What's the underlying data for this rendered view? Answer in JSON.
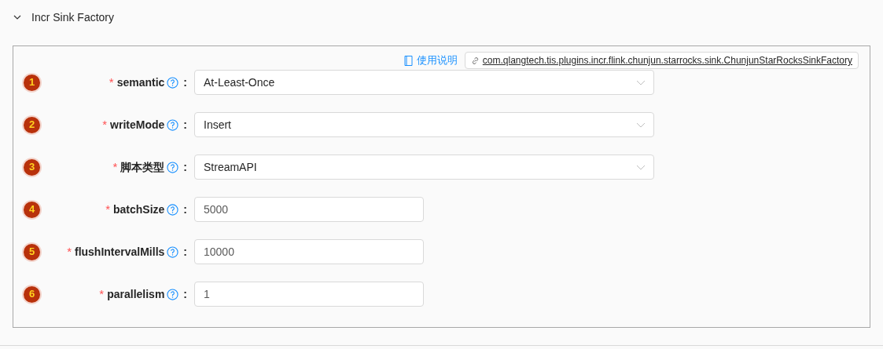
{
  "section": {
    "title": "Incr Sink Factory",
    "expanded": true
  },
  "doc_link": "使用说明",
  "plugin_link": "com.qlangtech.tis.plugins.incr.flink.chunjun.starrocks.sink.ChunjunStarRocksSinkFactory",
  "fields": [
    {
      "badge": "1",
      "label": "semantic",
      "required": true,
      "kind": "select",
      "value": "At-Least-Once"
    },
    {
      "badge": "2",
      "label": "writeMode",
      "required": true,
      "kind": "select",
      "value": "Insert"
    },
    {
      "badge": "3",
      "label": "脚本类型",
      "required": true,
      "kind": "select",
      "value": "StreamAPI"
    },
    {
      "badge": "4",
      "label": "batchSize",
      "required": true,
      "kind": "input",
      "value": "5000"
    },
    {
      "badge": "5",
      "label": "flushIntervalMills",
      "required": true,
      "kind": "input",
      "value": "10000"
    },
    {
      "badge": "6",
      "label": "parallelism",
      "required": true,
      "kind": "input",
      "value": "1"
    }
  ],
  "colon": ":",
  "required_mark": "*"
}
